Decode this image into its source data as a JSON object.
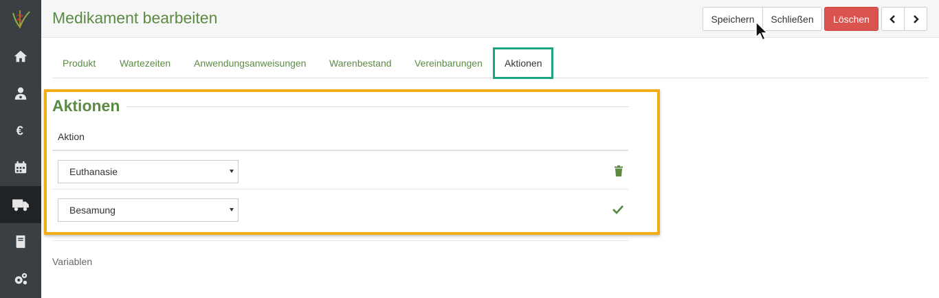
{
  "header": {
    "title": "Medikament bearbeiten",
    "buttons": {
      "save": "Speichern",
      "close": "Schließen",
      "delete": "Löschen"
    }
  },
  "sidebar": {
    "items": [
      {
        "icon": "home-icon"
      },
      {
        "icon": "user-doctor-icon"
      },
      {
        "icon": "euro-icon"
      },
      {
        "icon": "calendar-icon"
      },
      {
        "icon": "truck-icon",
        "active": true
      },
      {
        "icon": "book-icon"
      },
      {
        "icon": "cogs-icon"
      }
    ]
  },
  "tabs": [
    {
      "label": "Produkt"
    },
    {
      "label": "Wartezeiten"
    },
    {
      "label": "Anwendungsanweisungen"
    },
    {
      "label": "Warenbestand"
    },
    {
      "label": "Vereinbarungen"
    },
    {
      "label": "Aktionen",
      "active": true
    }
  ],
  "actions": {
    "title": "Aktionen",
    "column_header": "Aktion",
    "rows": [
      {
        "value": "Euthanasie",
        "icon": "trash-icon"
      },
      {
        "value": "Besamung",
        "icon": "check-icon"
      }
    ]
  },
  "variables_label": "Variablen",
  "colors": {
    "accent_green": "#5b8a45",
    "delete_red": "#d9534f",
    "sidebar": "#3a3f44",
    "highlight_orange": "#f3ad17",
    "highlight_teal": "#1aa383"
  }
}
